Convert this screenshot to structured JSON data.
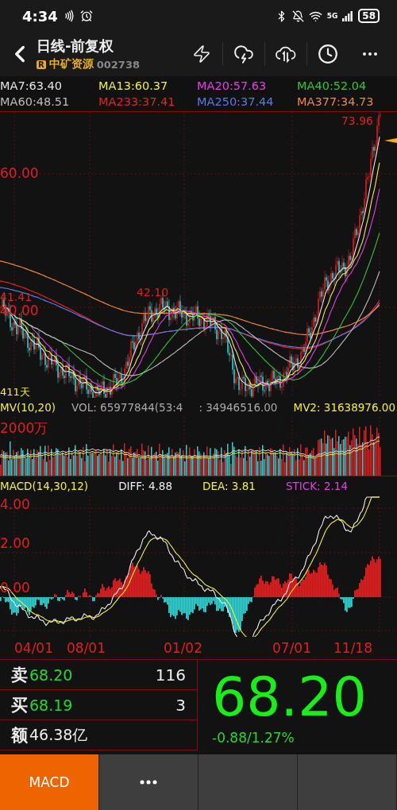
{
  "status_bar": {
    "time": "4:34",
    "network": "5G",
    "battery": "58"
  },
  "header": {
    "title": "日线-前复权",
    "badge": "R",
    "stock_name": "中矿资源",
    "stock_code": "002738"
  },
  "ma_legend": [
    {
      "label": "MA7:63.40",
      "color": "#e6e6e6"
    },
    {
      "label": "MA13:60.37",
      "color": "#f2ef3a"
    },
    {
      "label": "MA20:57.63",
      "color": "#e63ee6"
    },
    {
      "label": "MA40:52.04",
      "color": "#35c435"
    },
    {
      "label": "MA60:48.51",
      "color": "#bdbdbd"
    },
    {
      "label": "MA233:37.41",
      "color": "#e62222"
    },
    {
      "label": "MA250:37.44",
      "color": "#5a78e6"
    },
    {
      "label": "MA377:34.73",
      "color": "#f0883a"
    }
  ],
  "price_chart": {
    "axis_labels": [
      "60.00",
      "40.00"
    ],
    "peak_label": "73.96",
    "high_label": "42.10",
    "left_label": "41.41",
    "days_label": "411天"
  },
  "volume": {
    "title": "MV(10,20)",
    "vol": "VOL: 65977844(53:4",
    "mv1": ": 34946516.00",
    "mv2": "MV2: 31638976.00",
    "axis_label": "2000万"
  },
  "macd": {
    "title": "MACD(14,30,12)",
    "diff": "DIFF: 4.88",
    "dea": "DEA: 3.81",
    "stick": "STICK: 2.14",
    "axis_labels": [
      "4.00",
      "2.00",
      "0.00"
    ]
  },
  "dates": [
    "04/01",
    "08/01",
    "01/02",
    "07/01",
    "11/18"
  ],
  "quote": {
    "rows": [
      {
        "label": "卖",
        "price": "68.20",
        "amount": "116"
      },
      {
        "label": "买",
        "price": "68.19",
        "amount": "3"
      },
      {
        "label": "额",
        "price": "46.38亿"
      }
    ],
    "price": "68.20",
    "change": "-0.88/1.27%"
  },
  "bottom_tabs": [
    {
      "kind": "text",
      "label": "MACD",
      "selected": true
    },
    {
      "kind": "more",
      "selected": false
    },
    {
      "kind": "empty",
      "selected": false
    },
    {
      "kind": "empty",
      "selected": false
    }
  ]
}
